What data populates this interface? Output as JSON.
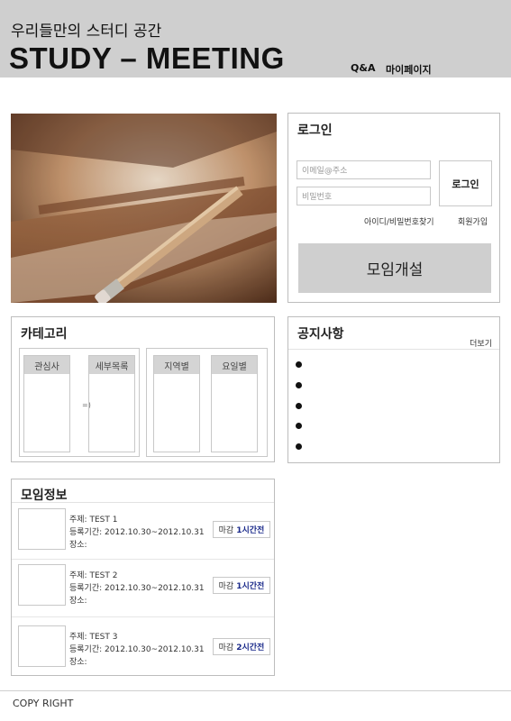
{
  "header": {
    "subtitle": "우리들만의 스터디 공간",
    "title": "STUDY – MEETING",
    "nav_qa": "Q&A",
    "nav_mypage": "마이페이지"
  },
  "login": {
    "title": "로그인",
    "email_placeholder": "이메일@주소",
    "password_placeholder": "비밀번호",
    "login_button": "로그인",
    "find_link": "아이디/비밀번호찾기",
    "join_link": "회원가입",
    "create_button": "모임개설"
  },
  "category": {
    "title": "카테고리",
    "col1": "관심사",
    "col2": "세부목록",
    "arrow": "=)",
    "col3": "지역별",
    "col4": "요일별"
  },
  "notice": {
    "title": "공지사항",
    "more": "더보기"
  },
  "meetings": {
    "title": "모임정보",
    "items": [
      {
        "subject": "주제:  TEST 1",
        "period": "등록기간:  2012.10.30~2012.10.31",
        "place": "장소:",
        "badge_prefix": "마감",
        "badge_time": "1시간전"
      },
      {
        "subject": "주제:  TEST 2",
        "period": "등록기간:  2012.10.30~2012.10.31",
        "place": "장소:",
        "badge_prefix": "마감",
        "badge_time": "1시간전"
      },
      {
        "subject": "주제:  TEST 3",
        "period": "등록기간:  2012.10.30~2012.10.31",
        "place": "장소:",
        "badge_prefix": "마감",
        "badge_time": "2시간전"
      }
    ]
  },
  "footer": {
    "copyright": "COPY RIGHT"
  }
}
